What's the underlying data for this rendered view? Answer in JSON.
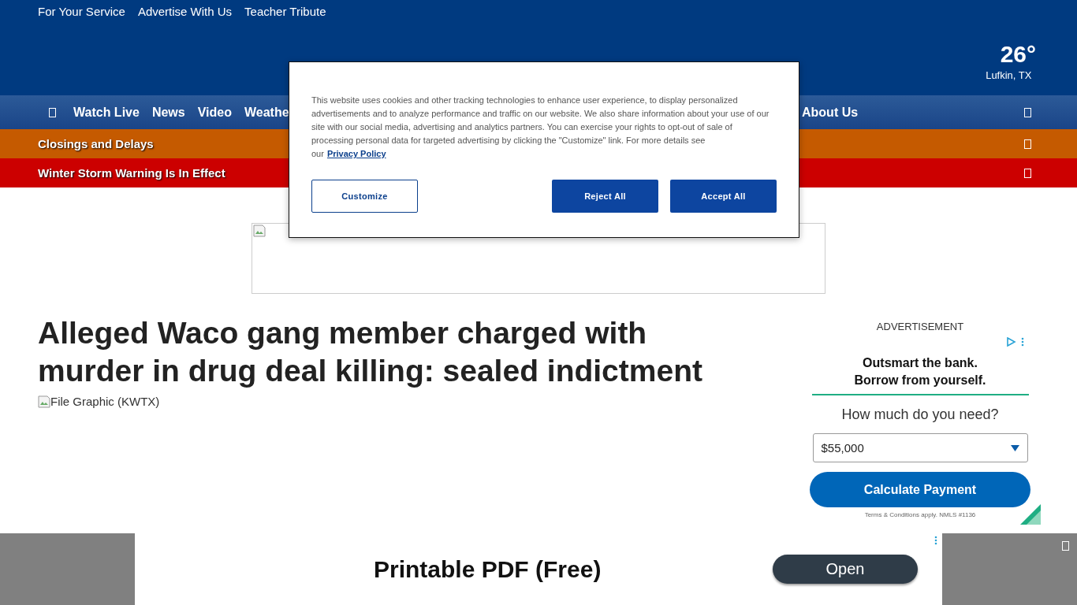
{
  "top_links": [
    "For Your Service",
    "Advertise With Us",
    "Teacher Tribute"
  ],
  "weather": {
    "temperature": "26°",
    "location": "Lufkin, TX"
  },
  "nav": {
    "items": [
      "Watch Live",
      "News",
      "Video",
      "Weathe"
    ],
    "right_item": "About Us"
  },
  "alerts": [
    {
      "text": "Closings and Delays",
      "color": "#c55a00"
    },
    {
      "text": "Winter Storm Warning Is In Effect",
      "color": "#cc0000"
    }
  ],
  "article": {
    "headline": "Alleged Waco gang member charged with murder in drug deal killing: sealed indictment",
    "image_alt": "File Graphic (KWTX)"
  },
  "side_ad": {
    "label": "ADVERTISEMENT",
    "headline_1": "Outsmart the bank.",
    "headline_2": "Borrow from yourself.",
    "question": "How much do you need?",
    "amount": "$55,000",
    "button": "Calculate Payment",
    "terms": "Terms & Conditions apply. NMLS #1136"
  },
  "bottom_ad": {
    "title": "Printable PDF (Free)",
    "button": "Open"
  },
  "cookie_dialog": {
    "text": "This website uses cookies and other tracking technologies to enhance user experience, to display personalized advertisements and to analyze performance and traffic on our website. We also share information about your use of our site with our social media, advertising and analytics partners. You can exercise your rights to opt-out of sale of processing personal data for targeted advertising by clicking the \"Customize\" link. For more details see our",
    "link": "Privacy Policy",
    "buttons": [
      {
        "label": "Customize",
        "kind": "outline"
      },
      {
        "label": "Reject All",
        "kind": "filled"
      },
      {
        "label": "Accept All",
        "kind": "filled"
      }
    ]
  }
}
